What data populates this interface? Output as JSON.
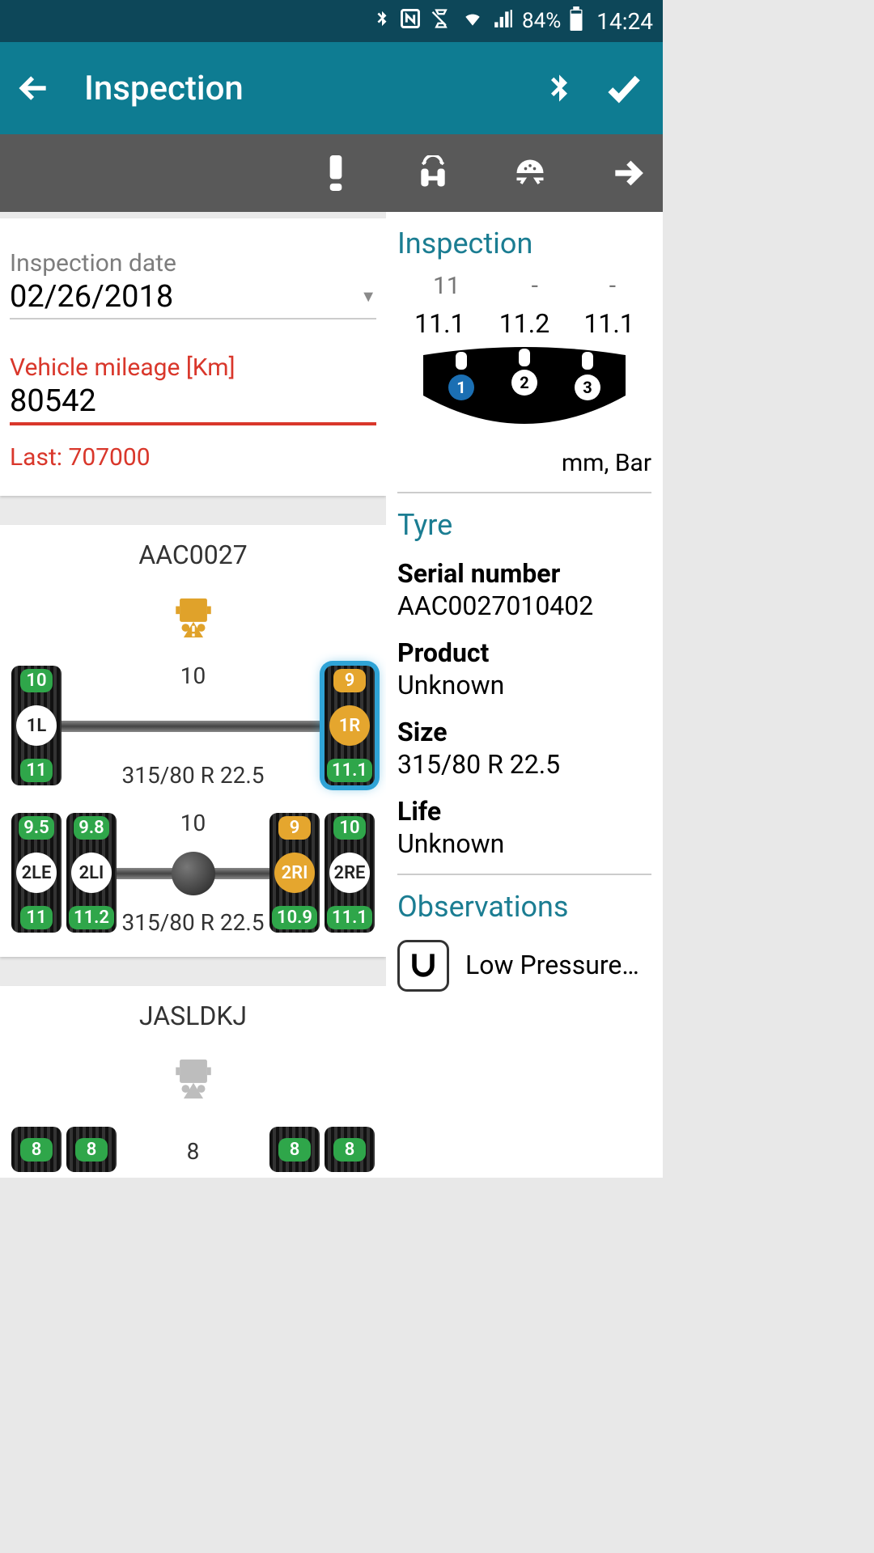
{
  "status": {
    "battery": "84%",
    "time": "14:24"
  },
  "appbar": {
    "title": "Inspection"
  },
  "form": {
    "date_label": "Inspection date",
    "date_value": "02/26/2018",
    "mileage_label": "Vehicle mileage [Km]",
    "mileage_value": "80542",
    "mileage_last": "Last: 707000"
  },
  "vehicle1": {
    "id": "AAC0027",
    "axle1": {
      "pressure": "10",
      "size": "315/80 R 22.5",
      "left": {
        "top": "10",
        "pos": "1L",
        "bot": "11",
        "top_cls": "g",
        "bot_cls": "g"
      },
      "right": {
        "top": "9",
        "pos": "1R",
        "bot": "11.1",
        "top_cls": "y",
        "bot_cls": "g",
        "selected": true
      }
    },
    "axle2": {
      "pressure": "10",
      "size": "315/80 R 22.5",
      "le": {
        "top": "9.5",
        "pos": "2LE",
        "bot": "11",
        "top_cls": "g",
        "bot_cls": "g"
      },
      "li": {
        "top": "9.8",
        "pos": "2LI",
        "bot": "11.2",
        "top_cls": "g",
        "bot_cls": "g"
      },
      "ri": {
        "top": "9",
        "pos": "2RI",
        "bot": "10.9",
        "top_cls": "y",
        "bot_cls": "g",
        "pos_y": true
      },
      "re": {
        "top": "10",
        "pos": "2RE",
        "bot": "11.1",
        "top_cls": "g",
        "bot_cls": "g"
      }
    }
  },
  "vehicle2": {
    "id": "JASLDKJ",
    "axle1": {
      "pressure": "8",
      "l1": "8",
      "l2": "8",
      "r1": "8",
      "r2": "8"
    }
  },
  "inspection_panel": {
    "heading": "Inspection",
    "row1": [
      "11",
      "-",
      "-"
    ],
    "row2": [
      "11.1",
      "11.2",
      "11.1"
    ],
    "units": "mm, Bar"
  },
  "tyre_panel": {
    "heading": "Tyre",
    "serial_label": "Serial number",
    "serial": "AAC0027010402",
    "product_label": "Product",
    "product": "Unknown",
    "size_label": "Size",
    "size": "315/80 R 22.5",
    "life_label": "Life",
    "life": "Unknown"
  },
  "observations": {
    "heading": "Observations",
    "item": "Low Pressure…"
  }
}
